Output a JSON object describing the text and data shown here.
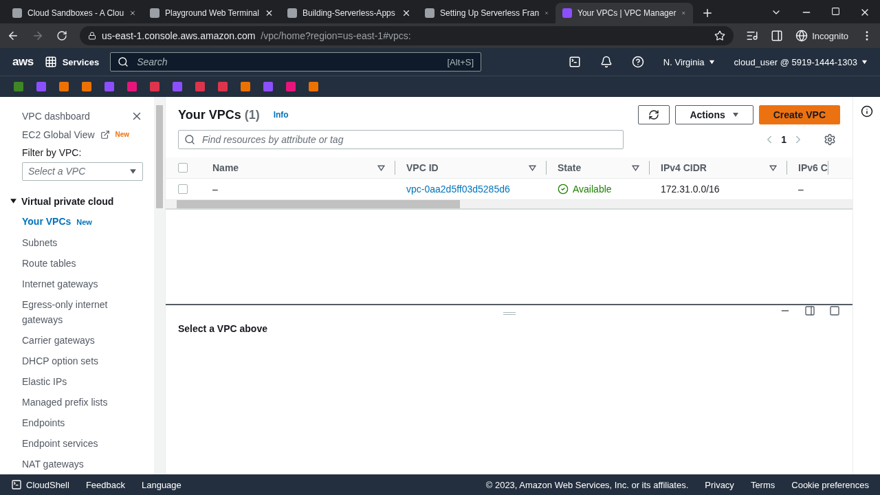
{
  "browser": {
    "tabs": [
      {
        "title": "Cloud Sandboxes - A Clou",
        "selected": false
      },
      {
        "title": "Playground Web Terminal",
        "selected": false
      },
      {
        "title": "Building-Serverless-Apps",
        "selected": false
      },
      {
        "title": "Setting Up Serverless Fran",
        "selected": false
      },
      {
        "title": "Your VPCs | VPC Manager",
        "selected": true
      }
    ],
    "url_host": "us-east-1.console.aws.amazon.com",
    "url_path": "/vpc/home?region=us-east-1#vpcs:",
    "profile": "Incognito"
  },
  "console_header": {
    "logo": "aws",
    "services": "Services",
    "search_placeholder": "Search",
    "search_shortcut": "[Alt+S]",
    "region": "N. Virginia",
    "account": "cloud_user @ 5919-1444-1303"
  },
  "favorites": [
    {
      "color": "#3f8624"
    },
    {
      "color": "#8c4fff"
    },
    {
      "color": "#ed7100"
    },
    {
      "color": "#ed7100"
    },
    {
      "color": "#8c4fff"
    },
    {
      "color": "#e7157b"
    },
    {
      "color": "#dd344c"
    },
    {
      "color": "#8c4fff"
    },
    {
      "color": "#dd344c"
    },
    {
      "color": "#dd344c"
    },
    {
      "color": "#ed7100"
    },
    {
      "color": "#8c4fff"
    },
    {
      "color": "#e7157b"
    },
    {
      "color": "#ed7100"
    }
  ],
  "sidebar": {
    "dashboard": "VPC dashboard",
    "global_view": "EC2 Global View",
    "global_view_badge": "New",
    "filter_label": "Filter by VPC:",
    "filter_placeholder": "Select a VPC",
    "section": {
      "title": "Virtual private cloud",
      "expanded": true,
      "items": [
        {
          "label": "Your VPCs",
          "badge": "New",
          "selected": true
        },
        {
          "label": "Subnets",
          "selected": false
        },
        {
          "label": "Route tables",
          "selected": false
        },
        {
          "label": "Internet gateways",
          "selected": false
        },
        {
          "label": "Egress-only internet gateways",
          "selected": false
        },
        {
          "label": "Carrier gateways",
          "selected": false
        },
        {
          "label": "DHCP option sets",
          "selected": false
        },
        {
          "label": "Elastic IPs",
          "selected": false
        },
        {
          "label": "Managed prefix lists",
          "selected": false
        },
        {
          "label": "Endpoints",
          "selected": false
        },
        {
          "label": "Endpoint services",
          "selected": false
        },
        {
          "label": "NAT gateways",
          "selected": false
        }
      ]
    }
  },
  "panel": {
    "title": "Your VPCs",
    "count": "(1)",
    "info": "Info",
    "actions": "Actions",
    "create": "Create VPC",
    "search_placeholder": "Find resources by attribute or tag",
    "page": "1",
    "table": {
      "select_all_checked": false,
      "columns": [
        "Name",
        "VPC ID",
        "State",
        "IPv4 CIDR",
        "IPv6 C"
      ],
      "rows": [
        {
          "checked": false,
          "name": "–",
          "vpc_id": "vpc-0aa2d5ff03d5285d6",
          "state": "Available",
          "ipv4": "172.31.0.0/16",
          "ipv6": "–"
        }
      ]
    }
  },
  "details": {
    "message": "Select a VPC above"
  },
  "footer": {
    "cloudshell": "CloudShell",
    "feedback": "Feedback",
    "language": "Language",
    "copyright": "© 2023, Amazon Web Services, Inc. or its affiliates.",
    "links": [
      "Privacy",
      "Terms",
      "Cookie preferences"
    ]
  }
}
